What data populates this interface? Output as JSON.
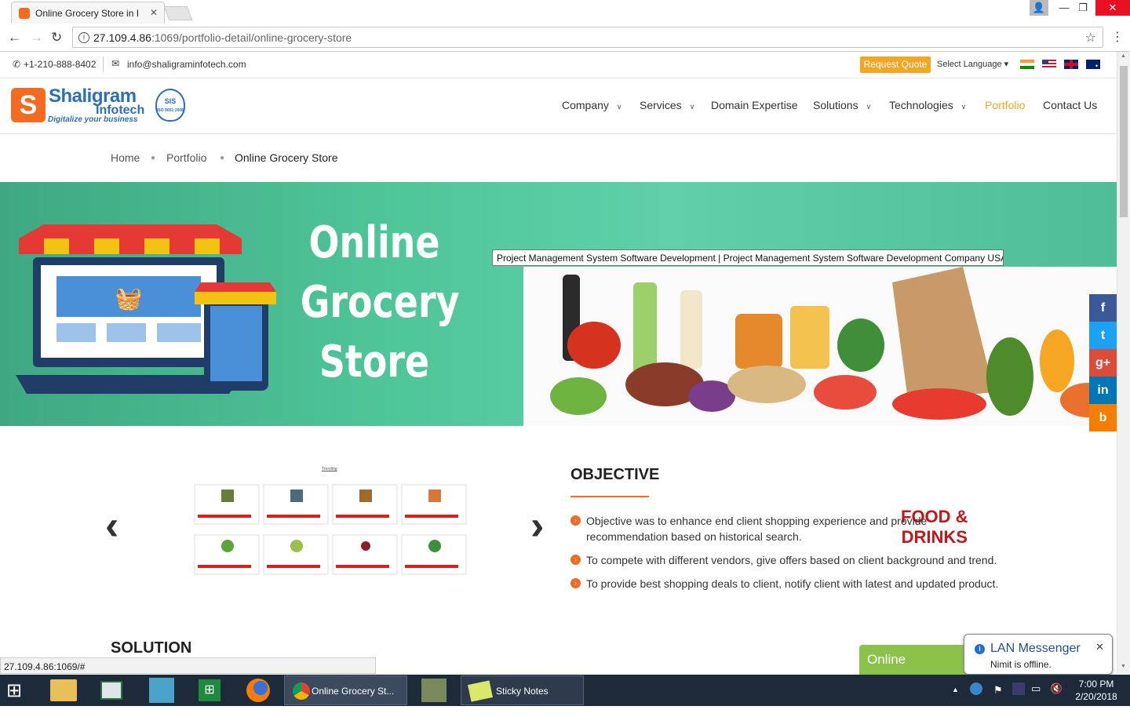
{
  "browser": {
    "tab_title": "Online Grocery Store in I",
    "tab_close": "✕",
    "url_host": "27.109.4.86",
    "url_rest": ":1069/portfolio-detail/online-grocery-store",
    "status_url": "27.109.4.86:1069/#",
    "window_controls": [
      "—",
      "❐",
      "✕"
    ],
    "nav_icons": [
      "back-icon",
      "forward-icon",
      "reload-icon"
    ]
  },
  "topbar": {
    "phone": "+1-210-888-8402",
    "email": "info@shaligraminfotech.com",
    "request_quote": "Request Quote",
    "select_language": "Select Language",
    "flags": [
      "india-flag-icon",
      "usa-flag-icon",
      "uk-flag-icon",
      "australia-flag-icon"
    ]
  },
  "logo": {
    "line1": "Shaligram",
    "line2": "Infotech",
    "tagline": "Digitalize your business",
    "badge": "ISO 9001:2008"
  },
  "nav": {
    "items": [
      {
        "label": "Company",
        "dropdown": true
      },
      {
        "label": "Services",
        "dropdown": true
      },
      {
        "label": "Domain Expertise",
        "dropdown": false
      },
      {
        "label": "Solutions",
        "dropdown": true
      },
      {
        "label": "Technologies",
        "dropdown": true
      },
      {
        "label": "Portfolio",
        "dropdown": false,
        "active": true
      },
      {
        "label": "Contact Us",
        "dropdown": false
      }
    ],
    "active_color": "#f3a623"
  },
  "breadcrumb": [
    "Home",
    "Portfolio",
    "Online Grocery Store"
  ],
  "banner": {
    "title_lines": [
      "Online",
      "Grocery",
      "Store"
    ],
    "tooltip": "Project Management System Software Development | Project Management System Software Development Company USA",
    "bag_text_1": "FOOD &",
    "bag_text_2": "DRINKS",
    "gallery_heading": "Trending"
  },
  "social": [
    {
      "name": "facebook",
      "glyph": "f",
      "color": "#3b5998"
    },
    {
      "name": "twitter",
      "glyph": "t",
      "color": "#1da1f2"
    },
    {
      "name": "google-plus",
      "glyph": "g+",
      "color": "#dd4b39"
    },
    {
      "name": "linkedin",
      "glyph": "in",
      "color": "#0077b5"
    },
    {
      "name": "blogger",
      "glyph": "b",
      "color": "#f57d00"
    }
  ],
  "objective": {
    "title": "OBJECTIVE",
    "points": [
      "Objective was to enhance end client shopping experience and provide recommendation based on historical search.",
      "To compete with different vendors, give offers based on client background and trend.",
      "To provide best shopping deals to client, notify client with latest and updated product."
    ]
  },
  "solution_title": "SOLUTION",
  "chat": {
    "status": "Online"
  },
  "notification": {
    "title": "LAN Messenger",
    "message": "Nimit is offline."
  },
  "taskbar": {
    "chrome_window": "Online Grocery St...",
    "sticky_window": "Sticky Notes",
    "time": "7:00 PM",
    "date": "2/20/2018"
  },
  "colors": {
    "brand_orange": "#f26b21",
    "brand_blue": "#2a6fb8",
    "banner_green": "#4fc59a"
  }
}
